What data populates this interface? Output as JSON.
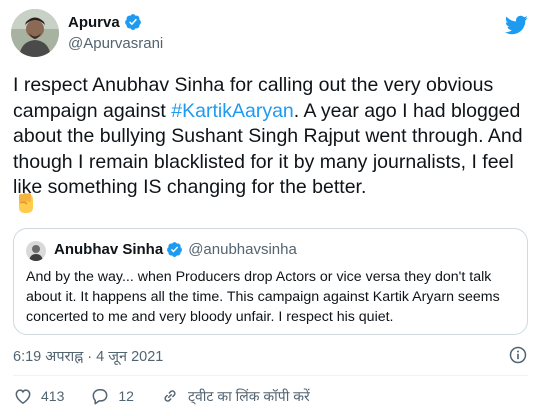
{
  "author": {
    "name": "Apurva",
    "handle": "@Apurvasrani"
  },
  "tweet": {
    "text_before": "I respect Anubhav Sinha for calling out the very obvious campaign against ",
    "hashtag": "#KartikAaryan",
    "text_after": ". A year ago I had blogged about the bullying Sushant Singh Rajput went through. And though I remain blacklisted for it by many journalists, I feel like something IS changing for the better.",
    "emoji": "raised-fist"
  },
  "quoted": {
    "name": "Anubhav Sinha",
    "handle": "@anubhavsinha",
    "text": "And by the way... when Producers drop Actors or vice versa they don't talk about it. It happens all the time. This campaign against Kartik Aryarn seems concerted to me and very bloody unfair. I respect his quiet."
  },
  "meta": {
    "timestamp": "6:19 अपराह्न · 4 जून 2021"
  },
  "actions": {
    "like_count": "413",
    "reply_count": "12",
    "share_label": "ट्वीट का लिंक कॉपी करें"
  },
  "colors": {
    "accent": "#1d9bf0",
    "text": "#0f1419",
    "secondary": "#536471",
    "border": "#cfd9de"
  },
  "icons": [
    "verified-badge-icon",
    "twitter-bird-icon",
    "info-icon",
    "heart-icon",
    "reply-icon",
    "link-icon"
  ]
}
